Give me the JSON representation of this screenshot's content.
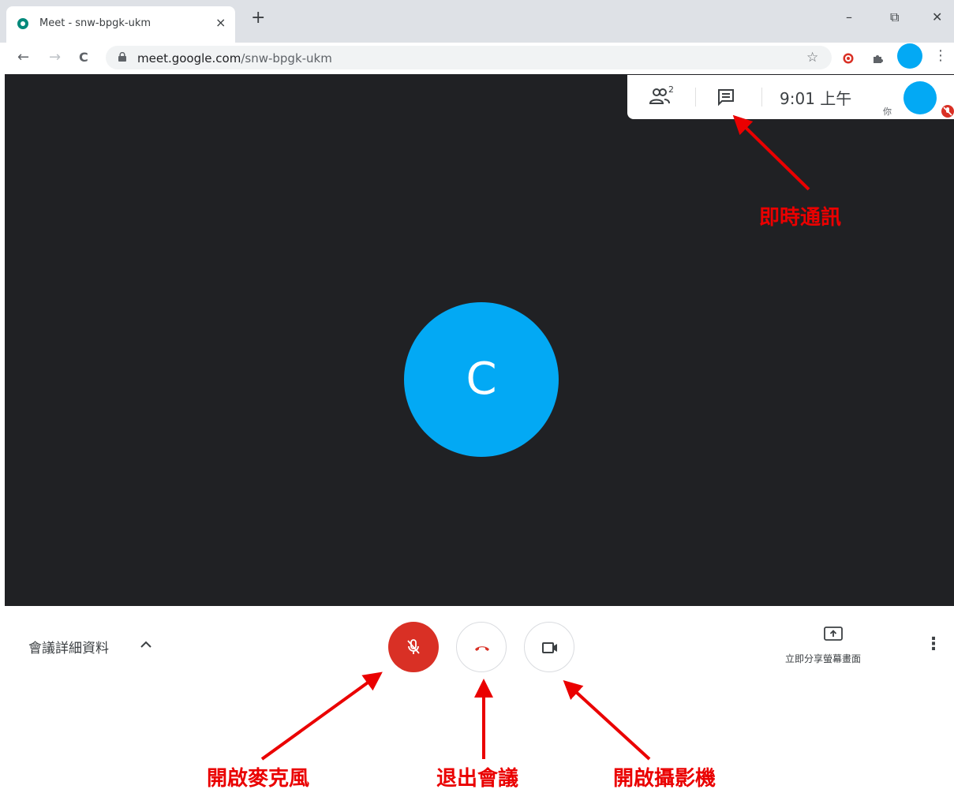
{
  "browser": {
    "tab_title": "Meet - snw-bpgk-ukm",
    "tab_close": "×",
    "new_tab": "+",
    "window_controls": {
      "minimize": "–",
      "restore": "⧉",
      "close": "✕"
    },
    "nav": {
      "back": "←",
      "forward": "→",
      "reload": "C"
    },
    "url_host": "meet.google.com",
    "url_path": "/snw-bpgk-ukm",
    "bookmark_star": "☆",
    "menu": "⋮",
    "icons": [
      "lock-icon",
      "star-icon",
      "target-extension-icon",
      "puzzle-extensions-icon",
      "profile-avatar",
      "kebab-menu-icon"
    ]
  },
  "meet": {
    "participant_count": "2",
    "clock": "9:01 上午",
    "you_label": "你",
    "main_participant_initial": "C",
    "avatar_color": "#03a9f4",
    "details_label": "會議詳細資料",
    "present_label": "立即分享螢幕畫面",
    "more_options": "⋮",
    "mic_button_color": "#d93025",
    "hangup_icon_color": "#d93025"
  },
  "annotations": {
    "chat": "即時通訊",
    "mic": "開啟麥克風",
    "leave": "退出會議",
    "camera": "開啟攝影機",
    "color": "#ea0000"
  }
}
